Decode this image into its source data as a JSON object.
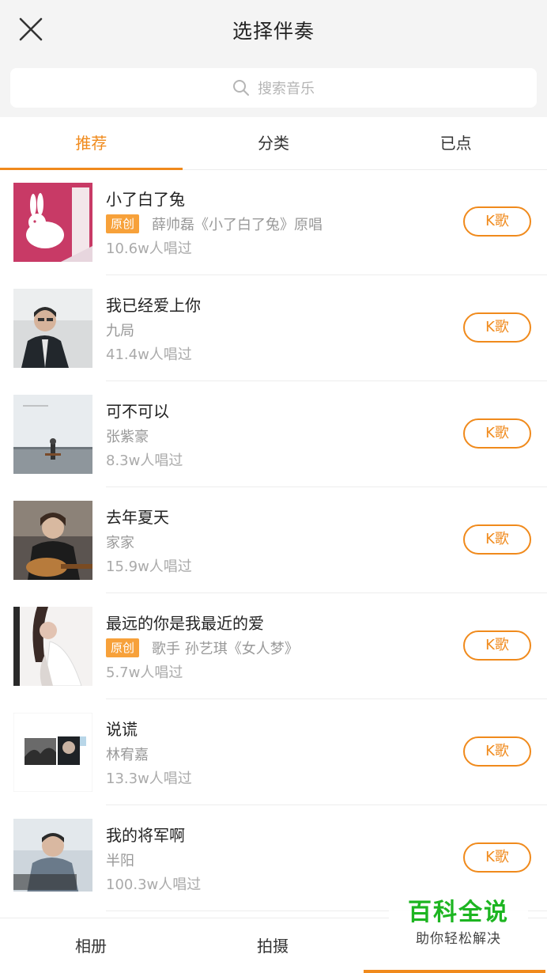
{
  "header": {
    "close_icon": "close-icon",
    "title": "选择伴奏"
  },
  "search": {
    "icon": "search-icon",
    "placeholder": "搜索音乐"
  },
  "tabs": [
    {
      "label": "推荐",
      "active": true
    },
    {
      "label": "分类",
      "active": false
    },
    {
      "label": "已点",
      "active": false
    }
  ],
  "songs": [
    {
      "name": "小了白了兔",
      "badge": "原创",
      "artist": "薛帅磊《小了白了兔》原唱",
      "plays": "10.6w人唱过",
      "button": "K歌"
    },
    {
      "name": "我已经爱上你",
      "badge": "",
      "artist": "九局",
      "plays": "41.4w人唱过",
      "button": "K歌"
    },
    {
      "name": "可不可以",
      "badge": "",
      "artist": "张紫豪",
      "plays": "8.3w人唱过",
      "button": "K歌"
    },
    {
      "name": "去年夏天",
      "badge": "",
      "artist": "家家",
      "plays": "15.9w人唱过",
      "button": "K歌"
    },
    {
      "name": "最远的你是我最近的爱",
      "badge": "原创",
      "artist": "歌手 孙艺琪《女人梦》",
      "plays": "5.7w人唱过",
      "button": "K歌"
    },
    {
      "name": "说谎",
      "badge": "",
      "artist": "林宥嘉",
      "plays": "13.3w人唱过",
      "button": "K歌"
    },
    {
      "name": "我的将军啊",
      "badge": "",
      "artist": "半阳",
      "plays": "100.3w人唱过",
      "button": "K歌"
    }
  ],
  "bottom_bar": [
    {
      "label": "相册",
      "active": false
    },
    {
      "label": "拍摄",
      "active": false
    },
    {
      "label": "",
      "active": true
    }
  ],
  "watermark": {
    "main": "百科全说",
    "sub": "助你轻松解决"
  },
  "colors": {
    "accent": "#f08a1c",
    "badge": "#f7a13a",
    "header_bg": "#f4f4f4",
    "watermark_green": "#1db521"
  }
}
